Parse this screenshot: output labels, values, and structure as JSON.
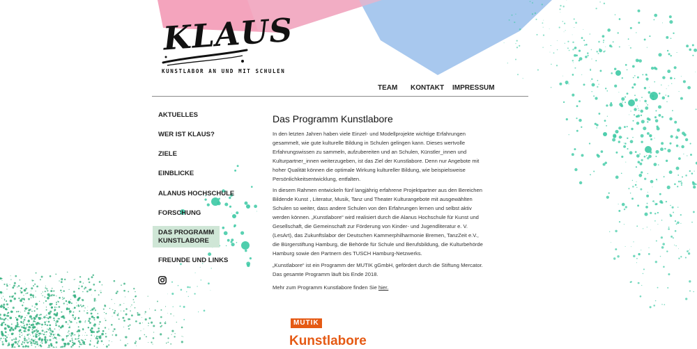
{
  "logo": {
    "wordmark": "KLAUS",
    "tagline": "KUNSTLABOR AN UND MIT SCHULEN"
  },
  "topnav": [
    {
      "label": "TEAM"
    },
    {
      "label": "KONTAKT"
    },
    {
      "label": "IMPRESSUM"
    }
  ],
  "sidebar": {
    "items": [
      {
        "label": "AKTUELLES"
      },
      {
        "label": "WER IST KLAUS?"
      },
      {
        "label": "ZIELE"
      },
      {
        "label": "EINBLICKE"
      },
      {
        "label": "ALANUS HOCHSCHULE"
      },
      {
        "label": "FORSCHUNG"
      },
      {
        "label": "DAS PROGRAMM KUNSTLABORE",
        "line1": "DAS PROGRAMM",
        "line2": "KUNSTLABORE",
        "active": true
      },
      {
        "label": "FREUNDE UND LINKS"
      }
    ],
    "social_icon": "instagram-icon"
  },
  "main": {
    "title": "Das Programm Kunstlabore",
    "paragraph1": "In den letzten Jahren haben viele Einzel- und Modellprojekte wichtige Erfahrungen gesammelt, wie gute kulturelle Bildung in Schulen gelingen kann. Dieses wertvolle Erfahrungswissen zu sammeln, aufzubereiten und an Schulen, Künstler_innen und Kulturpartner_innen weiterzugeben, ist das Ziel der Kunstlabore. Denn nur Angebote mit hoher Qualität können die optimale Wirkung kultureller Bildung, wie beispielsweise Persönlichkeitsentwicklung, entfalten.",
    "paragraph2": "In diesem Rahmen entwickeln fünf langjährig erfahrene Projektpartner aus den Bereichen Bildende Kunst , Literatur, Musik, Tanz und Theater Kulturangebote mit ausgewählten Schulen so weiter, dass andere Schulen von den Erfahrungen lernen und selbst aktiv werden können. „Kunstlabore“ wird realisiert durch die Alanus Hochschule für Kunst und Gesellschaft, die Gemeinschaft zur Förderung von Kinder- und Jugendliteratur e. V. (LesArt), das Zukunftslabor der Deutschen Kammerphilharmonie Bremen, TanzZeit e.V., die Bürgerstiftung Hamburg, die Behörde für Schule und Berufsbildung, die Kulturbehörde Hamburg sowie den Partnern des TUSCH Hamburg-Netzwerks.",
    "paragraph3": "„Kunstlabore“ ist ein Programm der MUTIK gGmbH, gefördert durch die Stiftung Mercator. Das gesamte Programm läuft bis Ende 2018.",
    "more_text": "Mehr zum Programm Kunstlabore finden Sie ",
    "more_link": "hier.",
    "brand_badge": "MUTIK",
    "brand_name": "Kunstlabore"
  },
  "colors": {
    "pink_paper": "#f4a4bd",
    "blue_paper": "#a8c8ee",
    "splatter_teal": "#3cc9a4",
    "splatter_green": "#2fae7c",
    "active_bg": "#cfe6d6",
    "brand_orange": "#e55a14"
  }
}
